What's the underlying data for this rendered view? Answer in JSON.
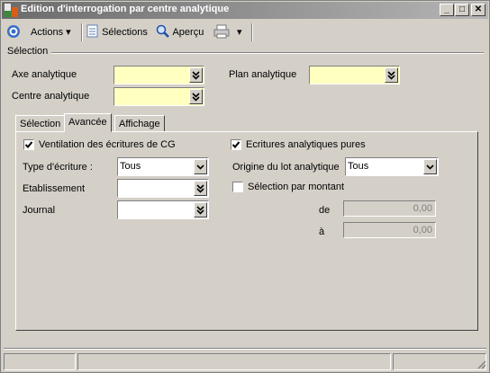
{
  "window": {
    "title": "Edition d'interrogation par centre analytique"
  },
  "titlebar_buttons": {
    "minimize": "_",
    "maximize": "□",
    "close": "✕"
  },
  "toolbar": {
    "actions_label": "Actions",
    "selections_label": "Sélections",
    "apercu_label": "Aperçu"
  },
  "selection": {
    "group_label": "Sélection",
    "axe_label": "Axe analytique",
    "axe_value": "",
    "plan_label": "Plan analytique",
    "plan_value": "",
    "centre_label": "Centre analytique",
    "centre_value": ""
  },
  "tabs": [
    {
      "label": "Sélection"
    },
    {
      "label": "Avancée"
    },
    {
      "label": "Affichage"
    }
  ],
  "active_tab": "Avancée",
  "advanced": {
    "ventilation_label": "Ventilation des écritures de CG",
    "ventilation_checked": true,
    "ecritures_pures_label": "Ecritures analytiques pures",
    "ecritures_pures_checked": true,
    "type_label": "Type d'écriture :",
    "type_value": "Tous",
    "origine_label": "Origine du lot analytique",
    "origine_value": "Tous",
    "etablissement_label": "Etablissement",
    "etablissement_value": "",
    "selection_montant_label": "Sélection par montant",
    "selection_montant_checked": false,
    "journal_label": "Journal",
    "journal_value": "",
    "de_label": "de",
    "de_value": "0,00",
    "a_label": "à",
    "a_value": "0,00"
  },
  "colors": {
    "titlebar_start": "#6b6b6b",
    "titlebar_end": "#b5b5b5",
    "required_field": "#ffffc0",
    "face": "#d4d0c8"
  }
}
